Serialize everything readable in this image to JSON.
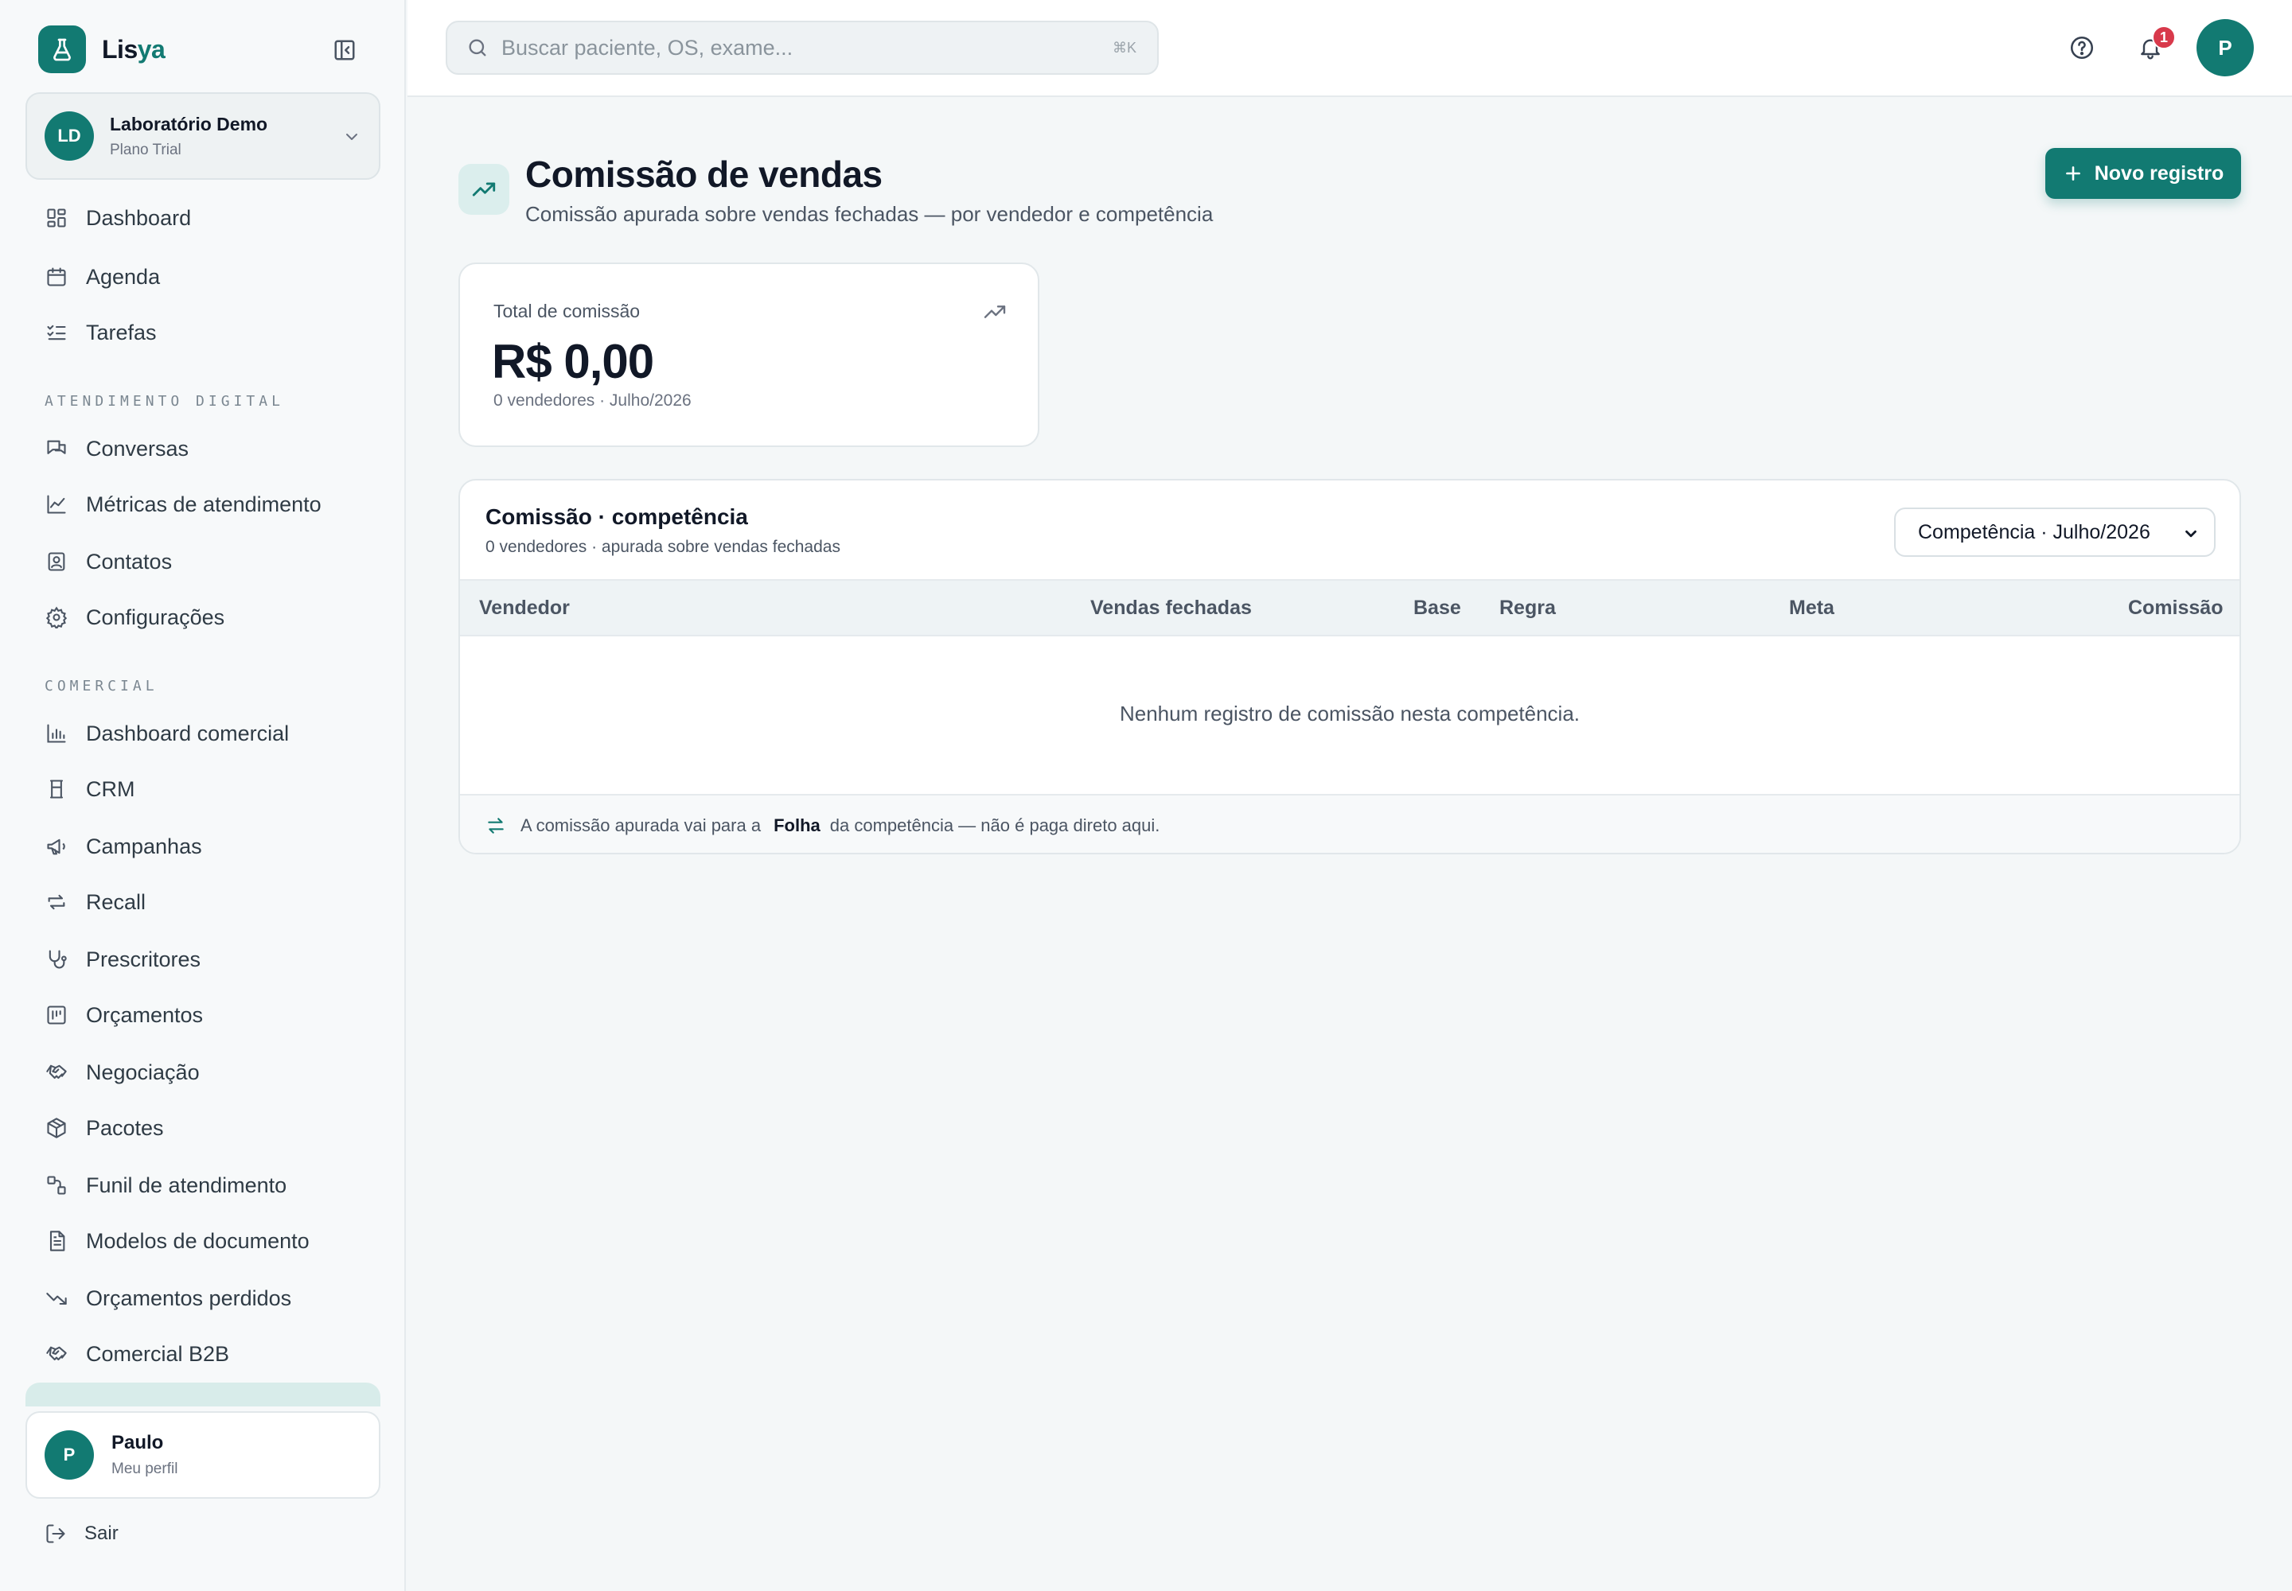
{
  "brand": {
    "name_main": "Lis",
    "name_accent": "ya"
  },
  "org": {
    "initials": "LD",
    "name": "Laboratório Demo",
    "plan": "Plano Trial"
  },
  "nav": {
    "main": [
      {
        "label": "Dashboard",
        "icon": "dashboard-icon"
      },
      {
        "label": "Agenda",
        "icon": "calendar-icon"
      },
      {
        "label": "Tarefas",
        "icon": "tasks-icon"
      }
    ],
    "section_digital": "ATENDIMENTO DIGITAL",
    "digital": [
      {
        "label": "Conversas",
        "icon": "chat-icon"
      },
      {
        "label": "Métricas de atendimento",
        "icon": "line-chart-icon"
      },
      {
        "label": "Contatos",
        "icon": "contacts-icon"
      },
      {
        "label": "Configurações",
        "icon": "gear-icon"
      }
    ],
    "section_comercial": "COMERCIAL",
    "comercial": [
      {
        "label": "Dashboard comercial",
        "icon": "bar-chart-icon"
      },
      {
        "label": "CRM",
        "icon": "crm-icon"
      },
      {
        "label": "Campanhas",
        "icon": "megaphone-icon"
      },
      {
        "label": "Recall",
        "icon": "arrows-swap-icon"
      },
      {
        "label": "Prescritores",
        "icon": "stethoscope-icon"
      },
      {
        "label": "Orçamentos",
        "icon": "quote-icon"
      },
      {
        "label": "Negociação",
        "icon": "handshake-icon"
      },
      {
        "label": "Pacotes",
        "icon": "package-icon"
      },
      {
        "label": "Funil de atendimento",
        "icon": "funnel-icon"
      },
      {
        "label": "Modelos de documento",
        "icon": "document-icon"
      },
      {
        "label": "Orçamentos perdidos",
        "icon": "trending-down-icon"
      },
      {
        "label": "Comercial B2B",
        "icon": "handshake-icon"
      }
    ]
  },
  "profile": {
    "initial": "P",
    "name": "Paulo",
    "sub": "Meu perfil",
    "logout": "Sair"
  },
  "topbar": {
    "search_placeholder": "Buscar paciente, OS, exame...",
    "search_shortcut": "⌘K",
    "notifications_count": "1",
    "user_initial": "P"
  },
  "page": {
    "title": "Comissão de vendas",
    "subtitle": "Comissão apurada sobre vendas fechadas — por vendedor e competência",
    "new_button": "Novo registro"
  },
  "stat": {
    "label": "Total de comissão",
    "value": "R$ 0,00",
    "meta": "0 vendedores · Julho/2026"
  },
  "table": {
    "title": "Comissão · competência",
    "subtitle": "0 vendedores · apurada sobre vendas fechadas",
    "select_value": "Competência · Julho/2026",
    "columns": [
      "Vendedor",
      "Vendas fechadas",
      "Base",
      "Regra",
      "Meta",
      "Comissão"
    ],
    "empty_text": "Nenhum registro de comissão nesta competência.",
    "footer_before": "A comissão apurada vai para a",
    "footer_strong": "Folha",
    "footer_after": "da competência — não é paga direto aqui."
  },
  "colors": {
    "accent": "#127a72",
    "badge": "#d8394b",
    "background": "#f4f7f8"
  }
}
